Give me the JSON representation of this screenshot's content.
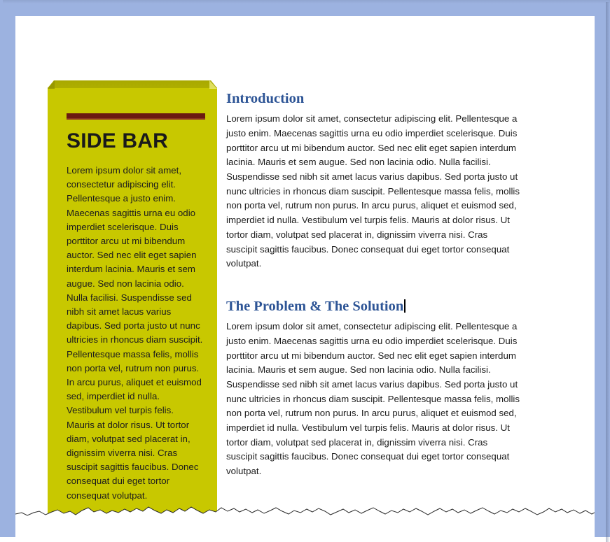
{
  "document": {
    "sidebar": {
      "title": "SIDE BAR",
      "rule_color": "#6A1A11",
      "background_color": "#C8C800",
      "text": "Lorem ipsum dolor sit amet, consectetur adipiscing elit. Pellentesque a justo enim. Maecenas sagittis urna eu odio imperdiet scelerisque. Duis porttitor arcu ut mi bibendum auctor. Sed nec elit eget sapien interdum lacinia. Mauris et sem augue. Sed non lacinia odio. Nulla facilisi. Suspendisse sed nibh sit amet lacus varius dapibus. Sed porta justo ut nunc ultricies in rhoncus diam suscipit. Pellentesque massa felis, mollis non porta vel, rutrum non purus. In arcu purus, aliquet et euismod sed, imperdiet id nulla. Vestibulum vel turpis felis. Mauris at dolor risus. Ut tortor diam, volutpat sed placerat in, dignissim viverra nisi. Cras suscipit sagittis faucibus. Donec consequat dui eget tortor consequat volutpat."
    },
    "sections": [
      {
        "heading": "Introduction",
        "heading_color": "#2E5596",
        "body": "Lorem ipsum dolor sit amet, consectetur adipiscing elit. Pellentesque a justo enim. Maecenas sagittis urna eu odio imperdiet scelerisque. Duis porttitor arcu ut mi bibendum auctor. Sed nec elit eget sapien interdum lacinia. Mauris et sem augue. Sed non lacinia odio. Nulla facilisi. Suspendisse sed nibh sit amet lacus varius dapibus. Sed porta justo ut nunc ultricies in rhoncus diam suscipit. Pellentesque massa felis, mollis non porta vel, rutrum non purus. In arcu purus, aliquet et euismod sed, imperdiet id nulla. Vestibulum vel turpis felis. Mauris at dolor risus. Ut tortor diam, volutpat sed placerat in, dignissim viverra nisi. Cras suscipit sagittis faucibus. Donec consequat dui eget tortor consequat volutpat."
      },
      {
        "heading": "The Problem & The Solution",
        "heading_color": "#2E5596",
        "body": "Lorem ipsum dolor sit amet, consectetur adipiscing elit. Pellentesque a justo enim. Maecenas sagittis urna eu odio imperdiet scelerisque. Duis porttitor arcu ut mi bibendum auctor. Sed nec elit eget sapien interdum lacinia. Mauris et sem augue. Sed non lacinia odio. Nulla facilisi. Suspendisse sed nibh sit amet lacus varius dapibus. Sed porta justo ut nunc ultricies in rhoncus diam suscipit. Pellentesque massa felis, mollis non porta vel, rutrum non purus. In arcu purus, aliquet et euismod sed, imperdiet id nulla. Vestibulum vel turpis felis. Mauris at dolor risus. Ut tortor diam, volutpat sed placerat in, dignissim viverra nisi. Cras suscipit sagittis faucibus. Donec consequat dui eget tortor consequat volutpat."
      }
    ],
    "frame": {
      "border_color": "#9CB2E0",
      "page_color": "#FFFFFF"
    },
    "bottom_edge": {
      "style": "torn-paper"
    }
  }
}
